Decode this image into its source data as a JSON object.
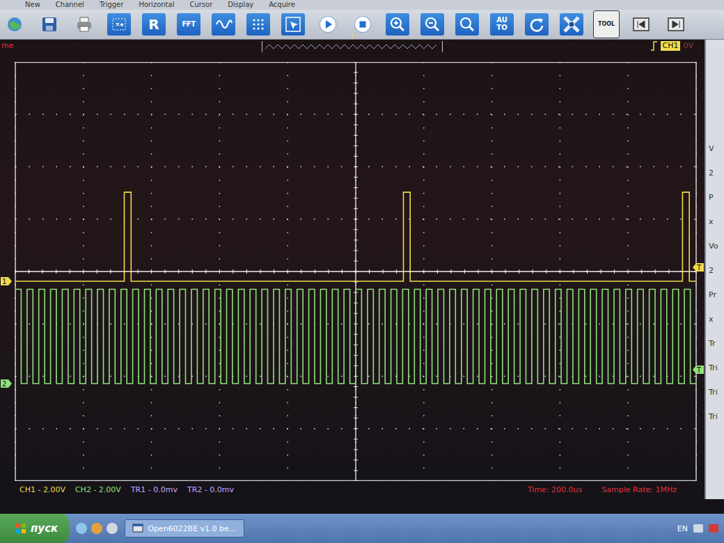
{
  "menu": [
    "New",
    "Channel",
    "Trigger",
    "Horizontal",
    "Cursor",
    "Display",
    "Acquire"
  ],
  "toolbar": {
    "labels": {
      "r": "R",
      "fft": "FFT",
      "auto": "AUTO",
      "tool": "TOOL"
    }
  },
  "header": {
    "cut_label": "me",
    "timeline_marker": "T",
    "trigger_channel": "CH1",
    "trigger_level": "0V"
  },
  "chart": {
    "channels": [
      {
        "name": "CH1",
        "marker": "1",
        "trigger_marker": "T",
        "color": "#f0dc4a",
        "values": [
          0,
          0,
          0,
          0,
          0,
          0,
          0,
          0,
          0,
          0,
          0,
          0,
          0,
          0,
          0,
          0,
          3.4,
          0,
          0,
          0,
          0,
          0,
          0,
          0,
          0,
          0,
          0,
          0,
          0,
          0,
          0,
          0,
          0,
          0,
          0,
          0,
          0,
          0,
          0,
          0,
          0,
          0,
          0,
          0,
          0,
          0,
          0,
          0,
          0,
          0,
          0,
          0,
          0,
          0,
          0,
          0,
          0,
          3.4,
          0,
          0,
          0,
          0,
          0,
          0,
          0,
          0,
          0,
          0,
          0,
          0,
          0,
          0,
          0,
          0,
          0,
          0,
          0,
          0,
          0,
          0,
          0,
          0,
          0,
          0,
          0,
          0,
          0,
          0,
          0,
          0,
          0,
          0,
          0,
          0,
          0,
          0,
          0,
          0,
          3.4,
          0
        ]
      },
      {
        "name": "CH2",
        "marker": "2",
        "trigger_marker": "T",
        "color": "#8fe27a",
        "values": [
          3.6,
          0,
          3.6,
          0,
          3.6,
          0,
          3.6,
          0,
          3.6,
          0,
          3.6,
          0,
          3.6,
          0,
          3.6,
          0,
          3.6,
          0,
          3.6,
          0,
          3.6,
          0,
          3.6,
          0,
          3.6,
          0,
          3.6,
          0,
          3.6,
          0,
          3.6,
          0,
          3.6,
          0,
          3.6,
          0,
          3.6,
          0,
          3.6,
          0,
          3.6,
          0,
          3.6,
          0,
          3.6,
          0,
          3.6,
          0,
          3.6,
          0,
          3.6,
          0,
          3.6,
          0,
          3.6,
          0,
          3.6,
          0,
          3.6,
          0,
          3.6,
          0,
          3.6,
          0,
          3.6,
          0,
          3.6,
          0,
          3.6,
          0,
          3.6,
          0,
          3.6,
          0,
          3.6,
          0,
          3.6,
          0,
          3.6,
          0,
          3.6,
          0,
          3.6,
          0,
          3.6,
          0,
          3.6,
          0,
          3.6,
          0,
          3.6,
          0,
          3.6,
          0,
          3.6,
          0,
          3.6,
          0,
          3.6,
          0,
          3.6,
          0,
          3.6,
          0,
          3.6,
          0,
          3.6,
          0,
          3.6,
          0,
          3.6,
          0,
          3.6,
          0,
          3.6,
          0
        ]
      }
    ]
  },
  "status": [
    {
      "text": "CH1 - 2.00V",
      "color": "#f0dc4a"
    },
    {
      "text": "CH2 - 2.00V",
      "color": "#8fe27a"
    },
    {
      "text": "TR1 - 0.0mv",
      "color": "#c9a6ff"
    },
    {
      "text": "TR2 - 0.0mv",
      "color": "#c9a6ff"
    },
    {
      "text": "Time: 200.0us",
      "color": "#e0303a"
    },
    {
      "text": "Sample Rate: 1MHz",
      "color": "#e0303a"
    }
  ],
  "right_panel": [
    "V",
    "2",
    "P",
    "x",
    "Vo",
    "2",
    "Pr",
    "x",
    "Tr",
    "Tri",
    "Tri",
    "Tri"
  ],
  "taskbar": {
    "start": "пуск",
    "app": "Open6022BE v1.0 be...",
    "language": "EN"
  }
}
